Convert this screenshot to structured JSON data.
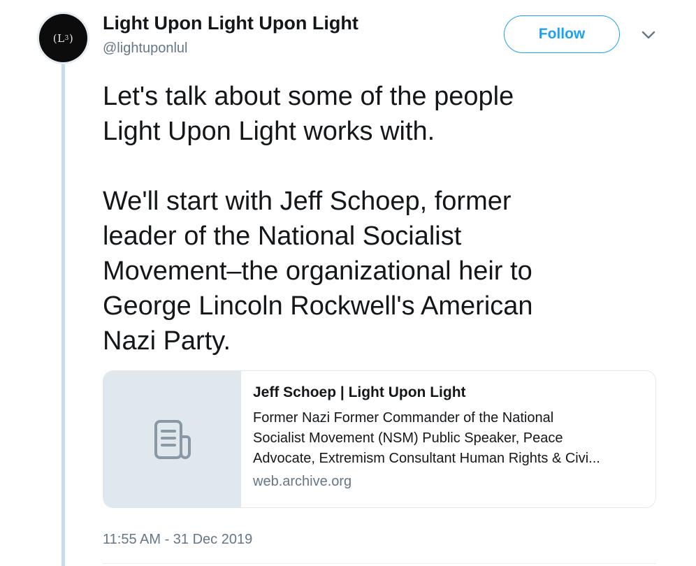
{
  "author": {
    "display_name": "Light Upon Light Upon Light",
    "handle": "@lightuponlul",
    "avatar_text": "(L",
    "avatar_sup": "3"
  },
  "actions": {
    "follow_label": "Follow",
    "more_icon": "chevron-down-icon"
  },
  "tweet": {
    "para1_lines": [
      "Let's talk about some of the people",
      "Light Upon Light works with."
    ],
    "para2_lines": [
      "We'll start with Jeff Schoep, former",
      "leader of the National Socialist",
      "Movement–the organizational heir to",
      "George Lincoln Rockwell's American",
      "Nazi Party."
    ],
    "timestamp": "11:55 AM - 31 Dec 2019"
  },
  "card": {
    "thumb_icon": "document-icon",
    "title": "Jeff Schoep | Light Upon Light",
    "description_lines": [
      "Former Nazi Former Commander of the National",
      "Socialist Movement (NSM) Public Speaker, Peace",
      "Advocate, Extremism Consultant Human Rights & Civi..."
    ],
    "domain": "web.archive.org"
  },
  "colors": {
    "accent": "#1da1f2",
    "thread_line": "#c4dcf2",
    "secondary_text": "#657786",
    "card_thumb_bg": "#e1e8ed"
  }
}
